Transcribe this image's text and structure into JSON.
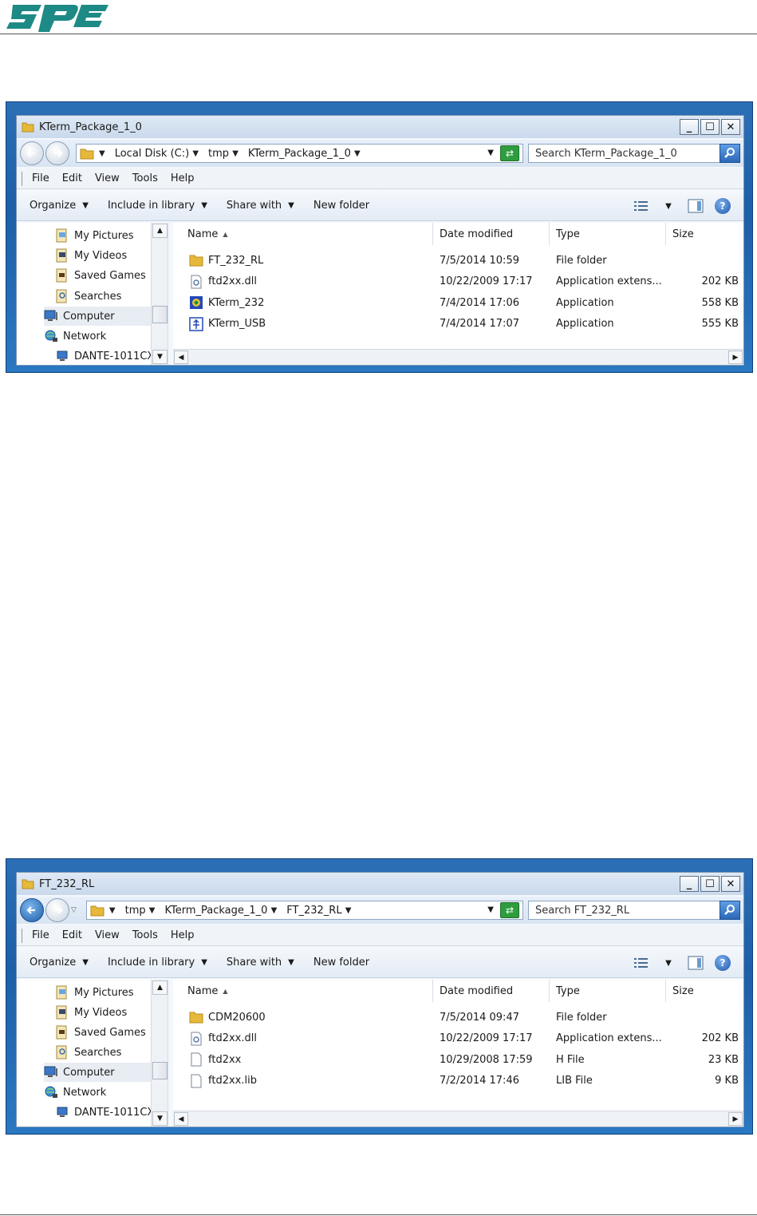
{
  "windows": [
    {
      "title": "KTerm_Package_1_0",
      "back_active": false,
      "breadcrumb": [
        "Local Disk (C:)",
        "tmp",
        "KTerm_Package_1_0"
      ],
      "search_placeholder": "Search KTerm_Package_1_0",
      "menu": [
        "File",
        "Edit",
        "View",
        "Tools",
        "Help"
      ],
      "toolbar": [
        "Organize",
        "Include in library",
        "Share with",
        "New folder"
      ],
      "nav": [
        "My Pictures",
        "My Videos",
        "Saved Games",
        "Searches",
        "Computer",
        "Network",
        "DANTE-1011CX"
      ],
      "columns": [
        "Name",
        "Date modified",
        "Type",
        "Size"
      ],
      "files": [
        {
          "name": "FT_232_RL",
          "date": "7/5/2014 10:59",
          "type": "File folder",
          "size": "",
          "icon": "folder-icon"
        },
        {
          "name": "ftd2xx.dll",
          "date": "10/22/2009 17:17",
          "type": "Application extens...",
          "size": "202 KB",
          "icon": "dll-icon"
        },
        {
          "name": "KTerm_232",
          "date": "7/4/2014 17:06",
          "type": "Application",
          "size": "558 KB",
          "icon": "app-icon"
        },
        {
          "name": "KTerm_USB",
          "date": "7/4/2014 17:07",
          "type": "Application",
          "size": "555 KB",
          "icon": "usb-app-icon"
        }
      ]
    },
    {
      "title": "FT_232_RL",
      "back_active": true,
      "breadcrumb": [
        "tmp",
        "KTerm_Package_1_0",
        "FT_232_RL"
      ],
      "search_placeholder": "Search FT_232_RL",
      "menu": [
        "File",
        "Edit",
        "View",
        "Tools",
        "Help"
      ],
      "toolbar": [
        "Organize",
        "Include in library",
        "Share with",
        "New folder"
      ],
      "nav": [
        "My Pictures",
        "My Videos",
        "Saved Games",
        "Searches",
        "Computer",
        "Network",
        "DANTE-1011CX"
      ],
      "columns": [
        "Name",
        "Date modified",
        "Type",
        "Size"
      ],
      "files": [
        {
          "name": "CDM20600",
          "date": "7/5/2014 09:47",
          "type": "File folder",
          "size": "",
          "icon": "folder-icon"
        },
        {
          "name": "ftd2xx.dll",
          "date": "10/22/2009 17:17",
          "type": "Application extens...",
          "size": "202 KB",
          "icon": "dll-icon"
        },
        {
          "name": "ftd2xx",
          "date": "10/29/2008 17:59",
          "type": "H File",
          "size": "23 KB",
          "icon": "file-icon"
        },
        {
          "name": "ftd2xx.lib",
          "date": "7/2/2014 17:46",
          "type": "LIB File",
          "size": "9 KB",
          "icon": "file-icon"
        }
      ]
    }
  ]
}
